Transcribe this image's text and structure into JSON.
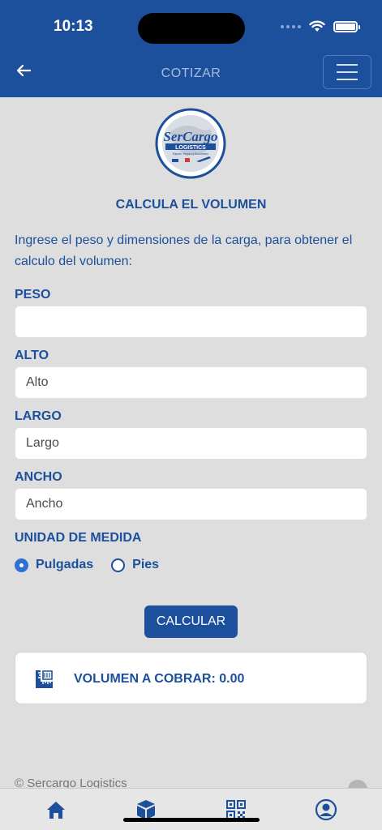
{
  "status": {
    "time": "10:13"
  },
  "nav": {
    "title": "COTIZAR",
    "back_icon": "arrow-left-icon",
    "menu_icon": "hamburger-icon"
  },
  "logo": {
    "brand": "SerCargo",
    "sub": "LOGISTICS",
    "tagline": "Rápido, Seguro y Económico"
  },
  "form": {
    "title": "CALCULA EL VOLUMEN",
    "intro": "Ingrese el peso y dimensiones de la carga, para obtener el calculo del volumen:",
    "peso_label": "PESO",
    "peso_value": "",
    "alto_label": "ALTO",
    "alto_placeholder": "Alto",
    "largo_label": "LARGO",
    "largo_placeholder": "Largo",
    "ancho_label": "ANCHO",
    "ancho_placeholder": "Ancho",
    "unit_label": "UNIDAD DE MEDIDA",
    "unit_options": [
      "Pulgadas",
      "Pies"
    ],
    "unit_selected": "Pulgadas",
    "calc_button": "CALCULAR"
  },
  "result": {
    "text": "VOLUMEN A COBRAR: 0.00",
    "icon": "ruler-icon"
  },
  "footer": {
    "copyright": "© Sercargo Logistics"
  },
  "tabs": [
    "home-icon",
    "package-icon",
    "qr-code-icon",
    "profile-icon"
  ],
  "colors": {
    "primary": "#1c4f9c",
    "accent": "#2f6fd6",
    "background": "#dedede"
  }
}
